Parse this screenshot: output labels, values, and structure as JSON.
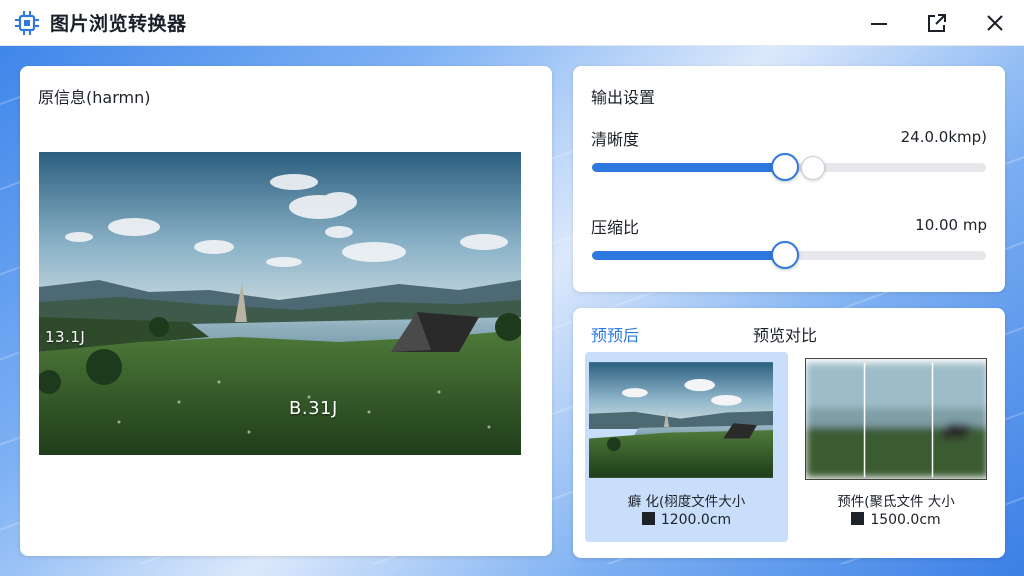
{
  "window": {
    "title": "图片浏览转换器",
    "app_icon": "chip-icon",
    "controls": [
      "minimize-icon",
      "popout-icon",
      "close-icon"
    ]
  },
  "source": {
    "title": "原信息(harmn)",
    "image_labels": [
      "13.1J",
      "B.31J"
    ]
  },
  "settings": {
    "title": "输出设置",
    "sharpness": {
      "label": "清晰度",
      "value_text": "24.0.0kmp)",
      "level": 0.49,
      "secondary_level": 0.56
    },
    "compression": {
      "label": "压缩比",
      "value_text": "10.00 mp",
      "level": 0.49
    }
  },
  "preview": {
    "tabs": [
      {
        "label": "预预后",
        "active": true
      },
      {
        "label": "预览对比",
        "active": false
      }
    ],
    "cards": [
      {
        "caption": "癖 化(栩度文件大小",
        "size": "1200.0cm",
        "selected": true
      },
      {
        "caption": "预件(聚氐文件 大小",
        "size": "1500.0cm",
        "selected": false
      }
    ]
  },
  "colors": {
    "accent": "#2f78e0",
    "card_selected": "#c8defa",
    "background": "#3d7fe0"
  }
}
